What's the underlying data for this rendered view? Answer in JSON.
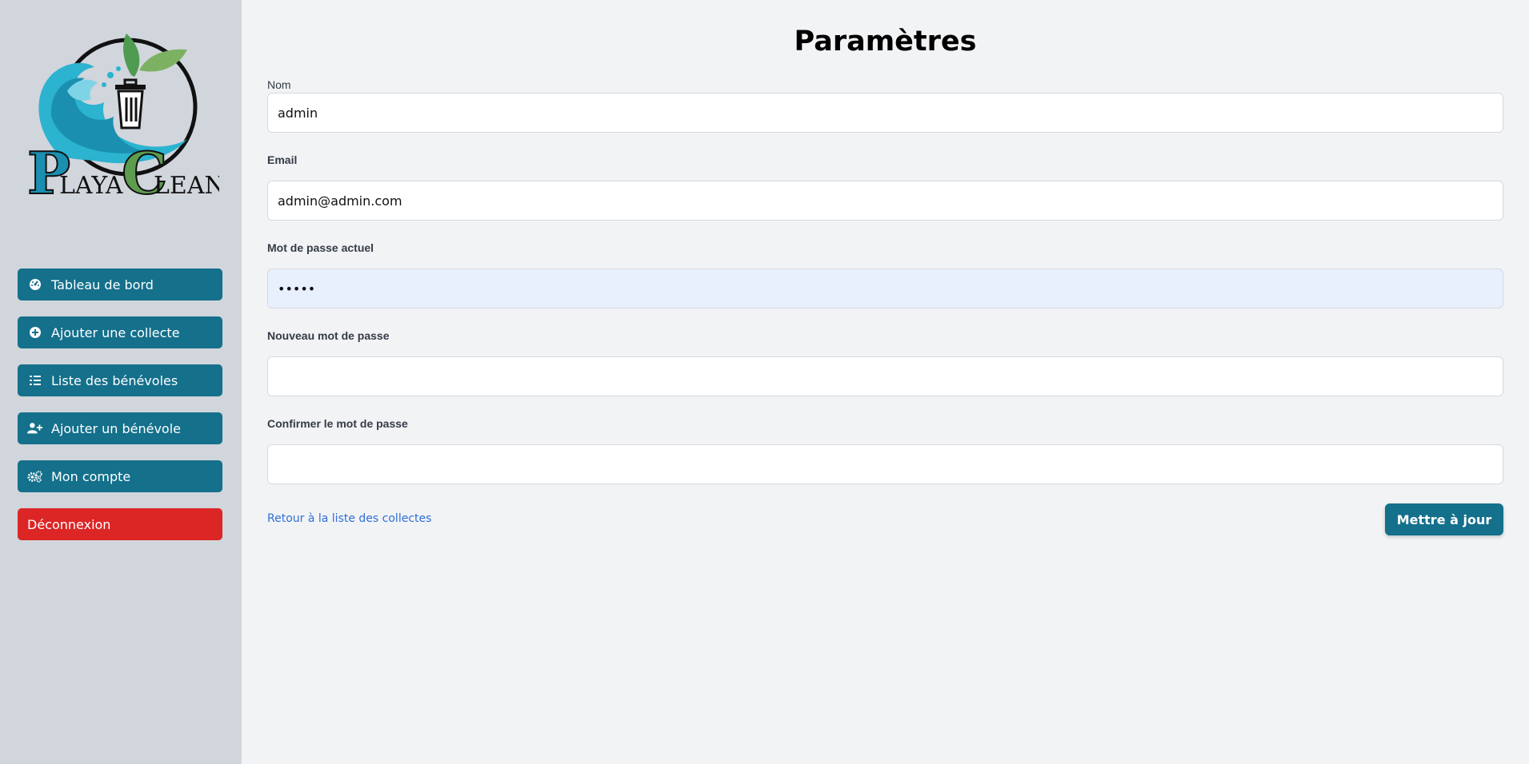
{
  "brand": {
    "name": "PlayaClean"
  },
  "sidebar": {
    "items": [
      {
        "label": "Tableau de bord",
        "icon": "dashboard-icon"
      },
      {
        "label": "Ajouter une collecte",
        "icon": "plus-circle-icon"
      },
      {
        "label": "Liste des bénévoles",
        "icon": "list-icon"
      },
      {
        "label": "Ajouter un bénévole",
        "icon": "user-plus-icon"
      },
      {
        "label": "Mon compte",
        "icon": "gears-icon"
      }
    ],
    "logout_label": "Déconnexion"
  },
  "page": {
    "title": "Paramètres"
  },
  "form": {
    "name": {
      "label": "Nom",
      "value": "admin"
    },
    "email": {
      "label": "Email",
      "value": "admin@admin.com"
    },
    "current_password": {
      "label": "Mot de passe actuel",
      "value": "admin"
    },
    "new_password": {
      "label": "Nouveau mot de passe",
      "value": ""
    },
    "confirm_password": {
      "label": "Confirmer le mot de passe",
      "value": ""
    },
    "back_link": "Retour à la liste des collectes",
    "submit_label": "Mettre à jour"
  },
  "colors": {
    "primary": "#14708b",
    "danger": "#dc2626",
    "sidebar_bg": "#d1d5dc",
    "page_bg": "#f2f3f5",
    "link": "#2f6fd6"
  }
}
